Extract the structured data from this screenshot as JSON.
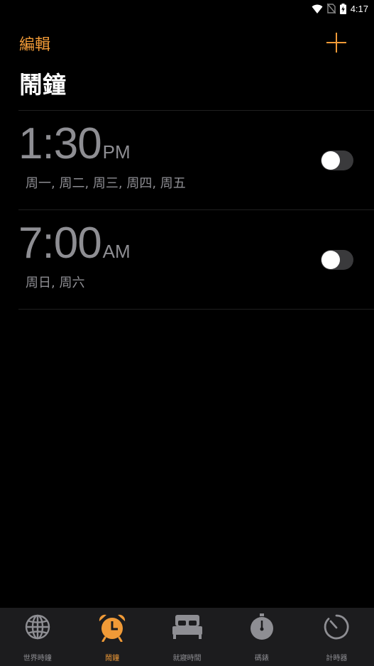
{
  "status_bar": {
    "time": "4:17",
    "icons": [
      "wifi-icon",
      "no-sim-icon",
      "battery-charging-icon"
    ]
  },
  "header": {
    "edit_label": "編輯",
    "add_icon": "plus-icon",
    "title": "鬧鐘"
  },
  "alarms": [
    {
      "time": "1:30",
      "period": "PM",
      "repeat": "周一, 周二, 周三, 周四, 周五",
      "enabled": false
    },
    {
      "time": "7:00",
      "period": "AM",
      "repeat": "周日, 周六",
      "enabled": false
    }
  ],
  "tabs": [
    {
      "label": "世界時鐘",
      "icon": "globe-icon",
      "active": false
    },
    {
      "label": "鬧鐘",
      "icon": "alarm-clock-icon",
      "active": true
    },
    {
      "label": "就寢時間",
      "icon": "bed-icon",
      "active": false
    },
    {
      "label": "碼錶",
      "icon": "stopwatch-icon",
      "active": false
    },
    {
      "label": "計時器",
      "icon": "timer-icon",
      "active": false
    }
  ],
  "colors": {
    "accent": "#f09a37",
    "background": "#000000",
    "inactive": "#8e8e93",
    "tabbar": "#1c1c1e"
  }
}
